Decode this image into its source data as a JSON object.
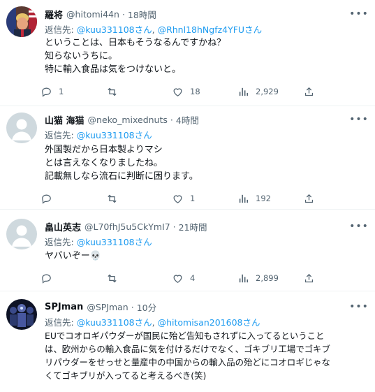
{
  "tweets": [
    {
      "name": "羅将",
      "handle": "@hitomi44n",
      "time": "18時間",
      "reply_prefix": "返信先:",
      "reply_to": [
        "@kuu331108さん",
        "@Rhnl18hNgfz4YFUさん"
      ],
      "lines": [
        "ということは、日本もそうなるんですかね？",
        "知らないうちに。",
        "特に輸入食品は気をつけないと。"
      ],
      "stats": {
        "reply": "1",
        "retweet": "",
        "like": "18",
        "views": "2,929"
      },
      "avatar": "photo-avatar"
    },
    {
      "name": "山猫 海猫",
      "handle": "@neko_mixednuts",
      "time": "4時間",
      "reply_prefix": "返信先:",
      "reply_to": [
        "@kuu331108さん"
      ],
      "lines": [
        "外国製だから日本製よりマシ",
        "とは言えなくなりましたね。",
        "記載無しなら流石に判断に困ります。"
      ],
      "stats": {
        "reply": "",
        "retweet": "",
        "like": "1",
        "views": "192"
      },
      "avatar": "default-avatar"
    },
    {
      "name": "畠山英志",
      "handle": "@L70fhJ5u5CkYmI7",
      "time": "21時間",
      "reply_prefix": "返信先:",
      "reply_to": [
        "@kuu331108さん"
      ],
      "lines": [
        "ヤバいぞー💀"
      ],
      "stats": {
        "reply": "",
        "retweet": "",
        "like": "4",
        "views": "2,899"
      },
      "avatar": "default-avatar"
    },
    {
      "name": "SPJman",
      "handle": "@SPJman",
      "time": "10分",
      "reply_prefix": "返信先:",
      "reply_to": [
        "@kuu331108さん",
        "@hitomisan201608さん"
      ],
      "lines": [
        "EUでコオロギパウダーが国民に殆ど告知もされずに入ってるということ",
        "は、欧州からの輸入食品に気を付けるだけでなく、ゴキブリ工場でゴキブ",
        "リパウダーをせっせと量産中の中国からの輸入品の殆どにコオロギじゃな",
        "くてゴキブリが入ってると考えるべき(笑)"
      ],
      "stats": {
        "reply": "",
        "retweet": "",
        "like": "",
        "views": ""
      },
      "avatar": "photo-avatar"
    }
  ],
  "sep": "·",
  "more_icon": "more-icon",
  "colors": {
    "link": "#1d9bf0",
    "muted": "#536471",
    "text": "#0f1419",
    "border": "#eff3f4"
  }
}
